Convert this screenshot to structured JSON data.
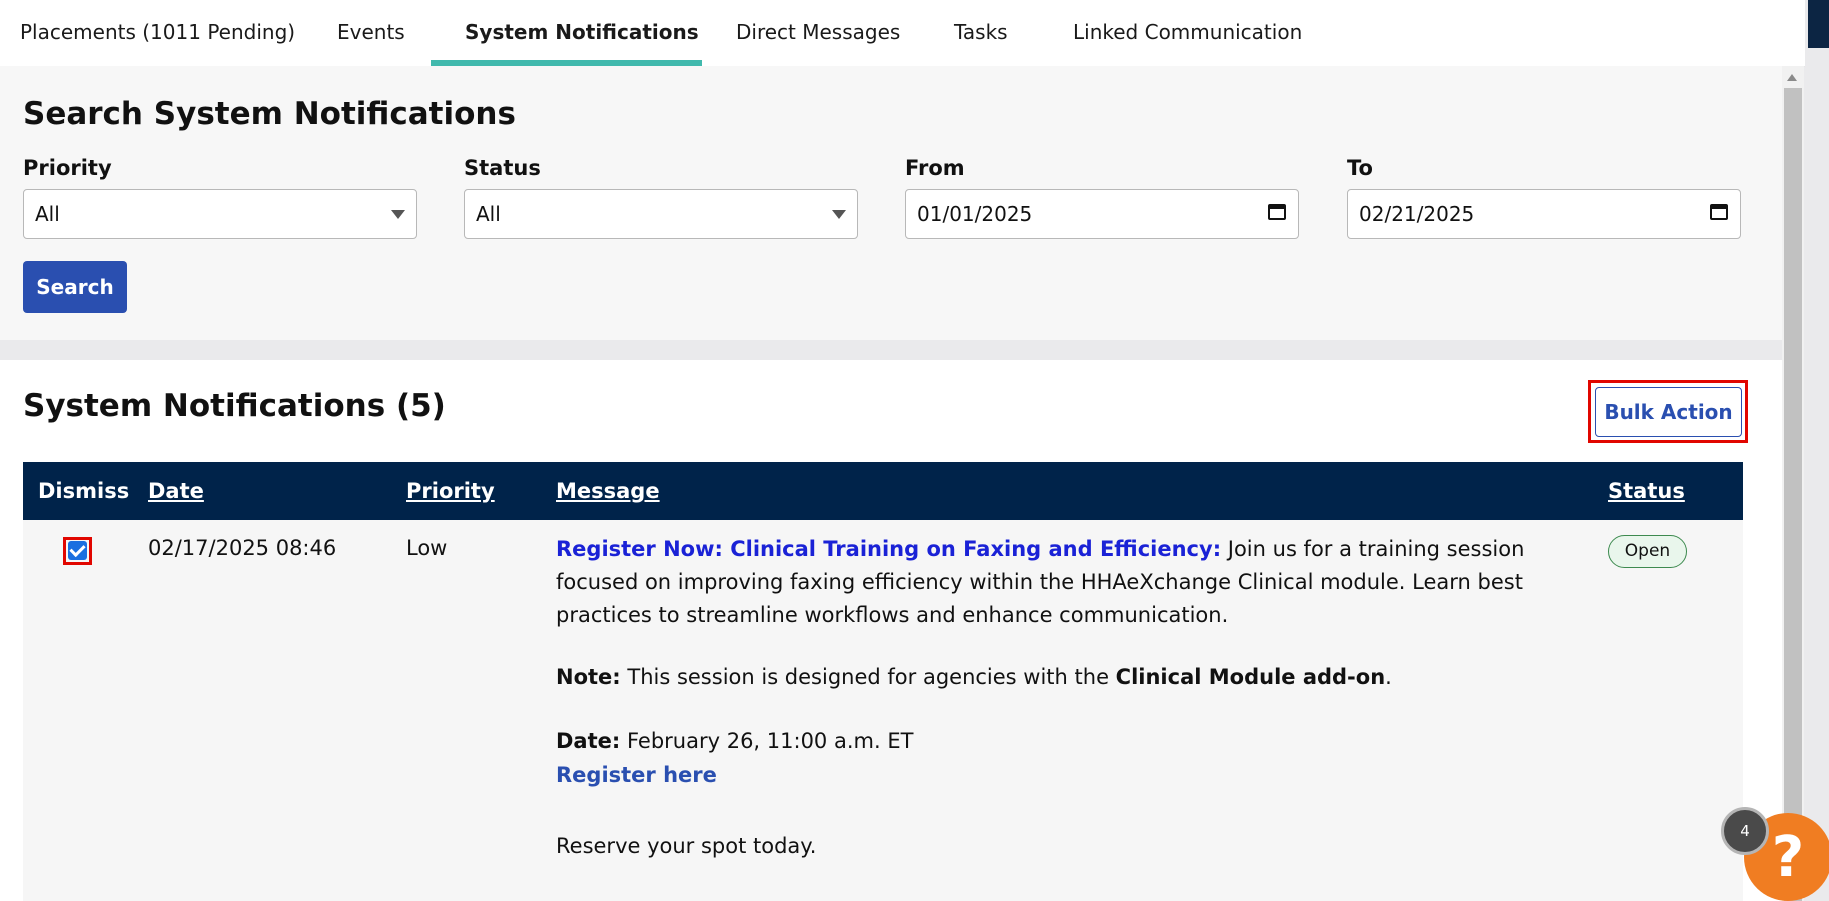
{
  "tabs": [
    {
      "label": "Placements (1011 Pending)",
      "active": false
    },
    {
      "label": "Events",
      "active": false
    },
    {
      "label": "System Notifications",
      "active": true
    },
    {
      "label": "Direct Messages",
      "active": false
    },
    {
      "label": "Tasks",
      "active": false
    },
    {
      "label": "Linked Communication",
      "active": false
    }
  ],
  "search": {
    "title": "Search System Notifications",
    "priority_label": "Priority",
    "priority_value": "All",
    "status_label": "Status",
    "status_value": "All",
    "from_label": "From",
    "from_value": "01/01/2025",
    "to_label": "To",
    "to_value": "02/21/2025",
    "button": "Search"
  },
  "results": {
    "title": "System Notifications (5)",
    "bulk_action": "Bulk Action",
    "columns": [
      "Dismiss",
      "Date",
      "Priority",
      "Message",
      "Status"
    ],
    "rows": [
      {
        "checked": true,
        "date": "02/17/2025 08:46",
        "priority": "Low",
        "message_title": "Register Now: Clinical Training on Faxing and Efficiency:",
        "message_body": " Join us for a training session focused on improving faxing efficiency within the HHAeXchange Clinical module. Learn best practices to streamline workflows and enhance communication.",
        "note_label": "Note:",
        "note_text": " This session is designed for agencies with the ",
        "note_bold": "Clinical Module add-on",
        "note_end": ".",
        "date_label": "Date:",
        "date_text": " February 26, 11:00 a.m. ET",
        "register_link": "Register here",
        "closing": "Reserve your spot today.",
        "status": "Open"
      }
    ]
  },
  "help": {
    "count": "4",
    "symbol": "?"
  },
  "colors": {
    "accent": "#41b9ad",
    "primary": "#2a4fb0",
    "header": "#00234a",
    "help": "#f07d22",
    "highlight": "#e10600"
  }
}
